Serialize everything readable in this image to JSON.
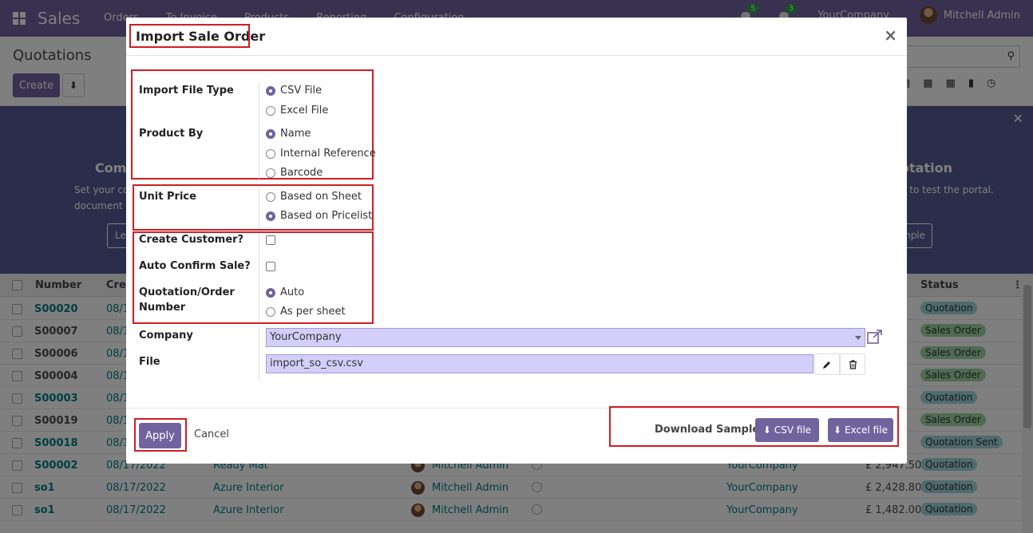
{
  "app": {
    "brand": "Sales",
    "menu": [
      "Orders",
      "To Invoice",
      "Products",
      "Reporting",
      "Configuration"
    ],
    "activity_count": "5",
    "message_count": "3",
    "company": "YourCompany",
    "user": "Mitchell Admin"
  },
  "control_panel": {
    "title": "Quotations",
    "create_label": "Create"
  },
  "banner": {
    "left_title": "Comp",
    "left_text": "Set your co document",
    "left_button": "Le",
    "right_title": "otation",
    "right_text": "n to test the portal.",
    "right_button": "mple"
  },
  "list": {
    "headers": {
      "number": "Number",
      "creation": "Crea",
      "status": "Status"
    },
    "rows": [
      {
        "number": "S00020",
        "link": true,
        "date": "08/1",
        "customer": "",
        "salesperson": "",
        "company": "",
        "amount": ".00",
        "status": "Quotation",
        "kind": "q"
      },
      {
        "number": "S00007",
        "link": false,
        "date": "08/1",
        "customer": "",
        "salesperson": "",
        "company": "",
        "amount": ".50",
        "status": "Sales Order",
        "kind": "so"
      },
      {
        "number": "S00006",
        "link": false,
        "date": "08/1",
        "customer": "",
        "salesperson": "",
        "company": "",
        "amount": ".50",
        "status": "Sales Order",
        "kind": "so"
      },
      {
        "number": "S00004",
        "link": false,
        "date": "08/1",
        "customer": "",
        "salesperson": "",
        "company": "",
        "amount": ".00",
        "status": "Sales Order",
        "kind": "so"
      },
      {
        "number": "S00003",
        "link": true,
        "date": "08/1",
        "customer": "",
        "salesperson": "",
        "company": "",
        "amount": ".50",
        "status": "Quotation",
        "kind": "q"
      },
      {
        "number": "S00019",
        "link": false,
        "date": "08/1",
        "customer": "",
        "salesperson": "",
        "company": "",
        "amount": ".50",
        "status": "Sales Order",
        "kind": "so"
      },
      {
        "number": "S00018",
        "link": true,
        "date": "08/1",
        "customer": "",
        "salesperson": "",
        "company": "",
        "amount": ".00",
        "status": "Quotation Sent",
        "kind": "q"
      },
      {
        "number": "S00002",
        "link": true,
        "date": "08/17/2022",
        "customer": "Ready Mat",
        "salesperson": "Mitchell Admin",
        "company": "YourCompany",
        "amount": "£ 2,947.50",
        "status": "Quotation",
        "kind": "q"
      },
      {
        "number": "so1",
        "link": true,
        "date": "08/17/2022",
        "customer": "Azure Interior",
        "salesperson": "Mitchell Admin",
        "company": "YourCompany",
        "amount": "£ 2,428.80",
        "status": "Quotation",
        "kind": "q"
      },
      {
        "number": "so1",
        "link": true,
        "date": "08/17/2022",
        "customer": "Azure Interior",
        "salesperson": "Mitchell Admin",
        "company": "YourCompany",
        "amount": "£ 1,482.00",
        "status": "Quotation",
        "kind": "q"
      }
    ]
  },
  "modal": {
    "title": "Import Sale Order",
    "close_glyph": "×",
    "fields": {
      "import_file_type": {
        "label": "Import File Type",
        "options": [
          "CSV File",
          "Excel File"
        ],
        "selected": 0
      },
      "product_by": {
        "label": "Product By",
        "options": [
          "Name",
          "Internal Reference",
          "Barcode"
        ],
        "selected": 0
      },
      "unit_price": {
        "label": "Unit Price",
        "options": [
          "Based on Sheet",
          "Based on Pricelist"
        ],
        "selected": 1
      },
      "create_customer": {
        "label": "Create Customer?"
      },
      "auto_confirm": {
        "label": "Auto Confirm Sale?"
      },
      "quotation_number": {
        "label_line1": "Quotation/Order",
        "label_line2": "Number",
        "options": [
          "Auto",
          "As per sheet"
        ],
        "selected": 0
      },
      "company": {
        "label": "Company",
        "value": "YourCompany"
      },
      "file": {
        "label": "File",
        "value": "import_so_csv.csv"
      }
    },
    "footer": {
      "apply": "Apply",
      "cancel": "Cancel",
      "download_label": "Download Sample:",
      "csv_button": "CSV file",
      "excel_button": "Excel file"
    }
  },
  "colors": {
    "brand": "#71639e",
    "highlight": "#d21d24",
    "input_bg": "#d4cefa"
  }
}
